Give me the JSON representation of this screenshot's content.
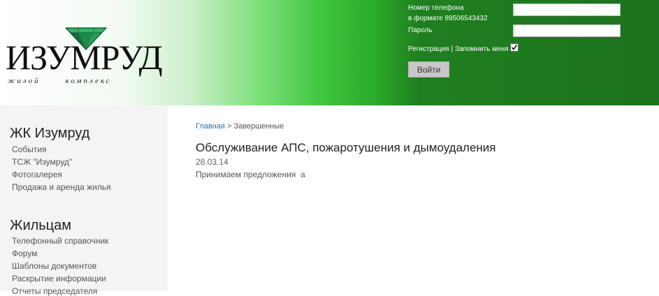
{
  "header": {
    "logo": {
      "title": "ИЗУМРУД",
      "subtitle_word1": "жилой",
      "subtitle_word2": "комплекс"
    },
    "login": {
      "phone_label_line1": "Номер телефона",
      "phone_label_line2": "в формате 89506543432",
      "password_label": "Пароль",
      "phone_value": "",
      "password_value": "",
      "register_link": "Регистрация",
      "separator": "|",
      "remember_label": "Запомнить меня",
      "remember_checked": true,
      "submit_label": "Войти"
    }
  },
  "sidebar": {
    "sections": [
      {
        "title": "ЖК Изумруд",
        "items": [
          "События",
          "ТСЖ \"Изумруд\"",
          "Фотогалерея",
          "Продажа и аренда жилья"
        ]
      },
      {
        "title": "Жильцам",
        "items": [
          "Телефонный справочник",
          "Форум",
          "Шаблоны документов",
          "Раскрытие информации",
          "Отчеты председателя"
        ]
      }
    ]
  },
  "content": {
    "breadcrumb": {
      "home": "Главная",
      "separator": ">",
      "current": "Завершенные"
    },
    "title": "Обслуживание АПС, пожаротушения и дымоудаления",
    "date": "28.03.14",
    "text": "Принимаем предложения  а"
  },
  "colors": {
    "header_green_dark": "#1d731d",
    "header_green_light": "#40c640",
    "sidebar_bg": "#f4f4f4",
    "link_blue": "#2a6ea0"
  }
}
